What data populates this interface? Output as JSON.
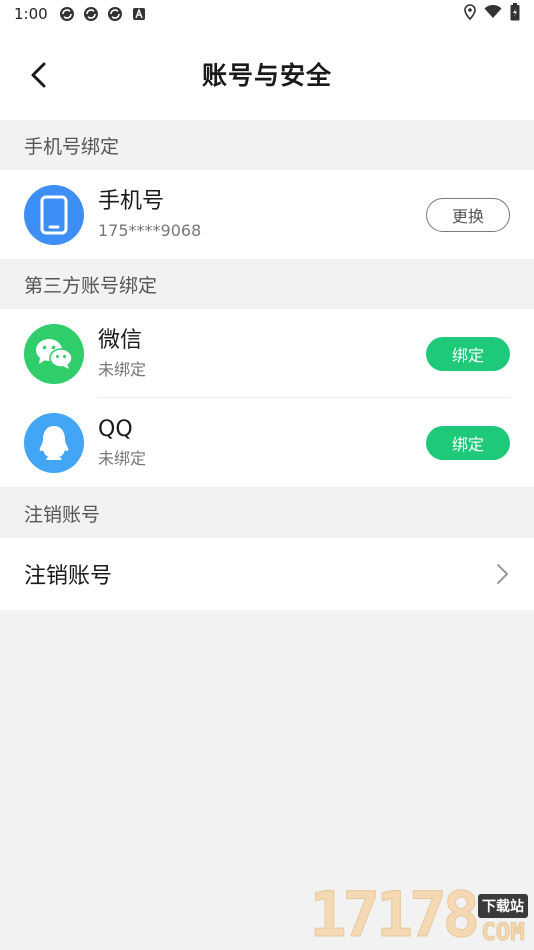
{
  "status_bar": {
    "time": "1:00",
    "left_icons": [
      "sync-icon",
      "sync-icon",
      "sync-icon",
      "a-icon"
    ],
    "right_icons": [
      "location-icon",
      "wifi-icon",
      "battery-icon"
    ]
  },
  "header": {
    "title": "账号与安全"
  },
  "sections": {
    "phone_label": "手机号绑定",
    "third_party_label": "第三方账号绑定",
    "deactivate_label": "注销账号"
  },
  "phone": {
    "name": "手机号",
    "number": "175****9068",
    "button": "更换",
    "color": "#3d8ff5"
  },
  "wechat": {
    "name": "微信",
    "status": "未绑定",
    "button": "绑定",
    "color": "#2fce6a"
  },
  "qq": {
    "name": "QQ",
    "status": "未绑定",
    "button": "绑定",
    "color": "#42a5f5"
  },
  "deactivate": {
    "label": "注销账号"
  },
  "watermark": {
    "digits": "17178",
    "tag_top": "下载站",
    "tag_bottom": "COM"
  },
  "colors": {
    "accent_green": "#1ec97a",
    "background": "#f2f2f2"
  }
}
